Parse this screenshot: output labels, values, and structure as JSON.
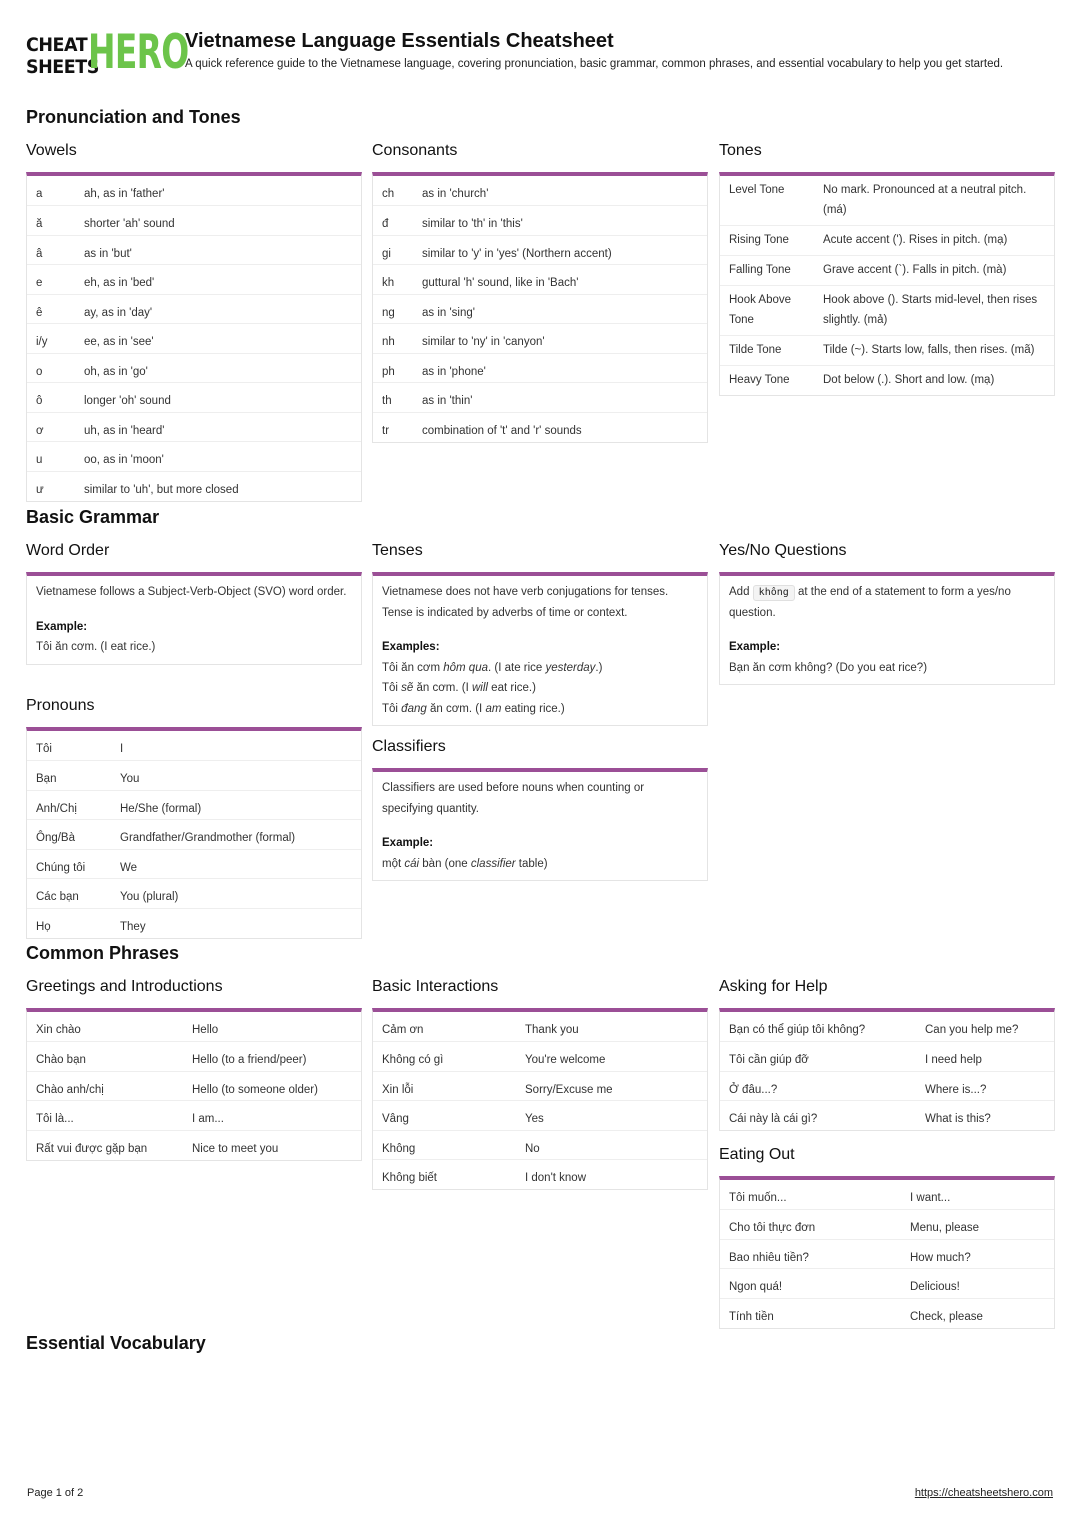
{
  "header": {
    "logo_top": "CHEAT",
    "logo_bottom": "SHEETS",
    "logo_hero": "HERO",
    "title": "Vietnamese Language Essentials Cheatsheet",
    "subtitle": "A quick reference guide to the Vietnamese language, covering pronunciation, basic grammar, common phrases, and essential vocabulary to help you get started."
  },
  "colors": {
    "accent": "#9b4f96",
    "brand_green": "#6cc44a"
  },
  "sections": {
    "pronunciation": {
      "title": "Pronunciation and Tones",
      "vowels": {
        "title": "Vowels",
        "rows": [
          [
            "a",
            "ah, as in 'father'"
          ],
          [
            "ă",
            "shorter 'ah' sound"
          ],
          [
            "â",
            "as in 'but'"
          ],
          [
            "e",
            "eh, as in 'bed'"
          ],
          [
            "ê",
            "ay, as in 'day'"
          ],
          [
            "i/y",
            "ee, as in 'see'"
          ],
          [
            "o",
            "oh, as in 'go'"
          ],
          [
            "ô",
            "longer 'oh' sound"
          ],
          [
            "ơ",
            "uh, as in 'heard'"
          ],
          [
            "u",
            "oo, as in 'moon'"
          ],
          [
            "ư",
            "similar to 'uh', but more closed"
          ]
        ]
      },
      "consonants": {
        "title": "Consonants",
        "rows": [
          [
            "ch",
            "as in 'church'"
          ],
          [
            "đ",
            "similar to 'th' in 'this'"
          ],
          [
            "gi",
            "similar to 'y' in 'yes' (Northern accent)"
          ],
          [
            "kh",
            "guttural 'h' sound, like in 'Bach'"
          ],
          [
            "ng",
            "as in 'sing'"
          ],
          [
            "nh",
            "similar to 'ny' in 'canyon'"
          ],
          [
            "ph",
            "as in 'phone'"
          ],
          [
            "th",
            "as in 'thin'"
          ],
          [
            "tr",
            "combination of 't' and 'r' sounds"
          ]
        ]
      },
      "tones": {
        "title": "Tones",
        "rows": [
          [
            "Level Tone",
            "No mark. Pronounced at a neutral pitch. (má)"
          ],
          [
            "Rising Tone",
            "Acute accent ('). Rises in pitch. (mạ)"
          ],
          [
            "Falling Tone",
            "Grave accent (`). Falls in pitch. (mà)"
          ],
          [
            "Hook Above Tone",
            "Hook above (). Starts mid-level, then rises slightly. (mả)"
          ],
          [
            "Tilde Tone",
            "Tilde (~). Starts low, falls, then rises. (mã)"
          ],
          [
            "Heavy Tone",
            "Dot below (.). Short and low. (mạ)"
          ]
        ]
      }
    },
    "grammar": {
      "title": "Basic Grammar",
      "word_order": {
        "title": "Word Order",
        "text": "Vietnamese follows a Subject-Verb-Object (SVO) word order.",
        "example_label": "Example:",
        "example": "Tôi ăn cơm. (I eat rice.)"
      },
      "tenses": {
        "title": "Tenses",
        "text": "Vietnamese does not have verb conjugations for tenses. Tense is indicated by adverbs of time or context.",
        "examples_label": "Examples:",
        "examples": [
          {
            "pre": "Tôi ăn cơm ",
            "em1": "hôm qua",
            "mid": ". (I ate rice ",
            "em2": "yesterday",
            "post": ".)"
          },
          {
            "pre": "Tôi ",
            "em1": "sẽ",
            "mid": " ăn cơm. (I ",
            "em2": "will",
            "post": " eat rice.)"
          },
          {
            "pre": "Tôi ",
            "em1": "đang",
            "mid": " ăn cơm. (I ",
            "em2": "am",
            "post": " eating rice.)"
          }
        ]
      },
      "yes_no": {
        "title": "Yes/No Questions",
        "text_pre": "Add ",
        "code": "không",
        "text_post": " at the end of a statement to form a yes/no question.",
        "example_label": "Example:",
        "example": "Bạn ăn cơm không? (Do you eat rice?)"
      },
      "pronouns": {
        "title": "Pronouns",
        "rows": [
          [
            "Tôi",
            "I"
          ],
          [
            "Bạn",
            "You"
          ],
          [
            "Anh/Chị",
            "He/She (formal)"
          ],
          [
            "Ông/Bà",
            "Grandfather/Grandmother (formal)"
          ],
          [
            "Chúng tôi",
            "We"
          ],
          [
            "Các bạn",
            "You (plural)"
          ],
          [
            "Họ",
            "They"
          ]
        ]
      },
      "classifiers": {
        "title": "Classifiers",
        "text": "Classifiers are used before nouns when counting or specifying quantity.",
        "example_label": "Example:",
        "example": {
          "pre": "một ",
          "em1": "cái",
          "mid": " bàn (one ",
          "em2": "classifier",
          "post": " table)"
        }
      }
    },
    "phrases": {
      "title": "Common Phrases",
      "greetings": {
        "title": "Greetings and Introductions",
        "rows": [
          [
            "Xin chào",
            "Hello"
          ],
          [
            "Chào bạn",
            "Hello (to a friend/peer)"
          ],
          [
            "Chào anh/chị",
            "Hello (to someone older)"
          ],
          [
            "Tôi là...",
            "I am..."
          ],
          [
            "Rất vui được gặp bạn",
            "Nice to meet you"
          ]
        ]
      },
      "interactions": {
        "title": "Basic Interactions",
        "rows": [
          [
            "Cảm ơn",
            "Thank you"
          ],
          [
            "Không có gì",
            "You're welcome"
          ],
          [
            "Xin lỗi",
            "Sorry/Excuse me"
          ],
          [
            "Vâng",
            "Yes"
          ],
          [
            "Không",
            "No"
          ],
          [
            "Không biết",
            "I don't know"
          ]
        ]
      },
      "help": {
        "title": "Asking for Help",
        "rows": [
          [
            "Bạn có thể giúp tôi không?",
            "Can you help me?"
          ],
          [
            "Tôi cần giúp đỡ",
            "I need help"
          ],
          [
            "Ở đâu...?",
            "Where is...?"
          ],
          [
            "Cái này là cái gì?",
            "What is this?"
          ]
        ]
      },
      "eating": {
        "title": "Eating Out",
        "rows": [
          [
            "Tôi muốn...",
            "I want..."
          ],
          [
            "Cho tôi thực đơn",
            "Menu, please"
          ],
          [
            "Bao nhiêu tiền?",
            "How much?"
          ],
          [
            "Ngon quá!",
            "Delicious!"
          ],
          [
            "Tính tiền",
            "Check, please"
          ]
        ]
      }
    },
    "vocabulary": {
      "title": "Essential Vocabulary"
    }
  },
  "footer": {
    "page": "Page 1 of 2",
    "link": "https://cheatsheetshero.com"
  }
}
